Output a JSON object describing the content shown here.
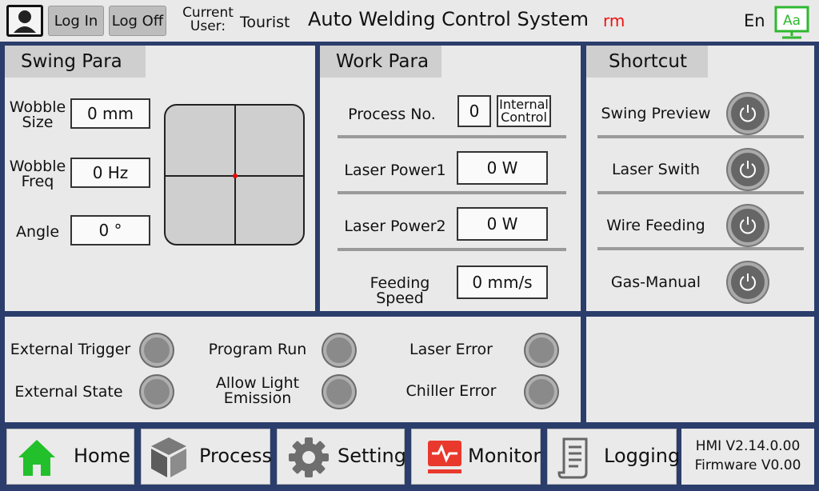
{
  "header": {
    "login_label": "Log In",
    "logoff_label": "Log Off",
    "current_user_label": "Current User:",
    "current_user": "Tourist",
    "title": "Auto Welding Control System",
    "status_text": "rm",
    "language": "En",
    "font_button_label": "Aa"
  },
  "swing": {
    "title": "Swing Para",
    "wobble_size_label": "Wobble Size",
    "wobble_size_value": "0 mm",
    "wobble_freq_label": "Wobble Freq",
    "wobble_freq_value": "0 Hz",
    "angle_label": "Angle",
    "angle_value": "0 °"
  },
  "work": {
    "title": "Work Para",
    "process_no_label": "Process No.",
    "process_no_value": "0",
    "control_mode": "Internal Control",
    "laser_power1_label": "Laser Power1",
    "laser_power1_value": "0 W",
    "laser_power2_label": "Laser Power2",
    "laser_power2_value": "0 W",
    "feeding_speed_label": "Feeding Speed",
    "feeding_speed_value": "0 mm/s"
  },
  "shortcut": {
    "title": "Shortcut",
    "items": [
      {
        "label": "Swing Preview"
      },
      {
        "label": "Laser Swith"
      },
      {
        "label": "Wire Feeding"
      },
      {
        "label": "Gas-Manual"
      }
    ]
  },
  "status": {
    "external_trigger": "External Trigger",
    "external_state": "External State",
    "program_run": "Program Run",
    "allow_light_emission": "Allow Light Emission",
    "laser_error": "Laser Error",
    "chiller_error": "Chiller Error"
  },
  "nav": {
    "home": "Home",
    "process": "Process",
    "setting": "Setting",
    "monitor": "Monitor",
    "logging": "Logging"
  },
  "version": {
    "hmi": "HMI V2.14.0.00",
    "firmware": "Firmware  V0.00"
  },
  "colors": {
    "border": "#2b3d6b",
    "panel": "#e9e9e9",
    "home_icon": "#22c02a",
    "monitor_icon": "#e8392c",
    "status_text": "#ee1111"
  }
}
